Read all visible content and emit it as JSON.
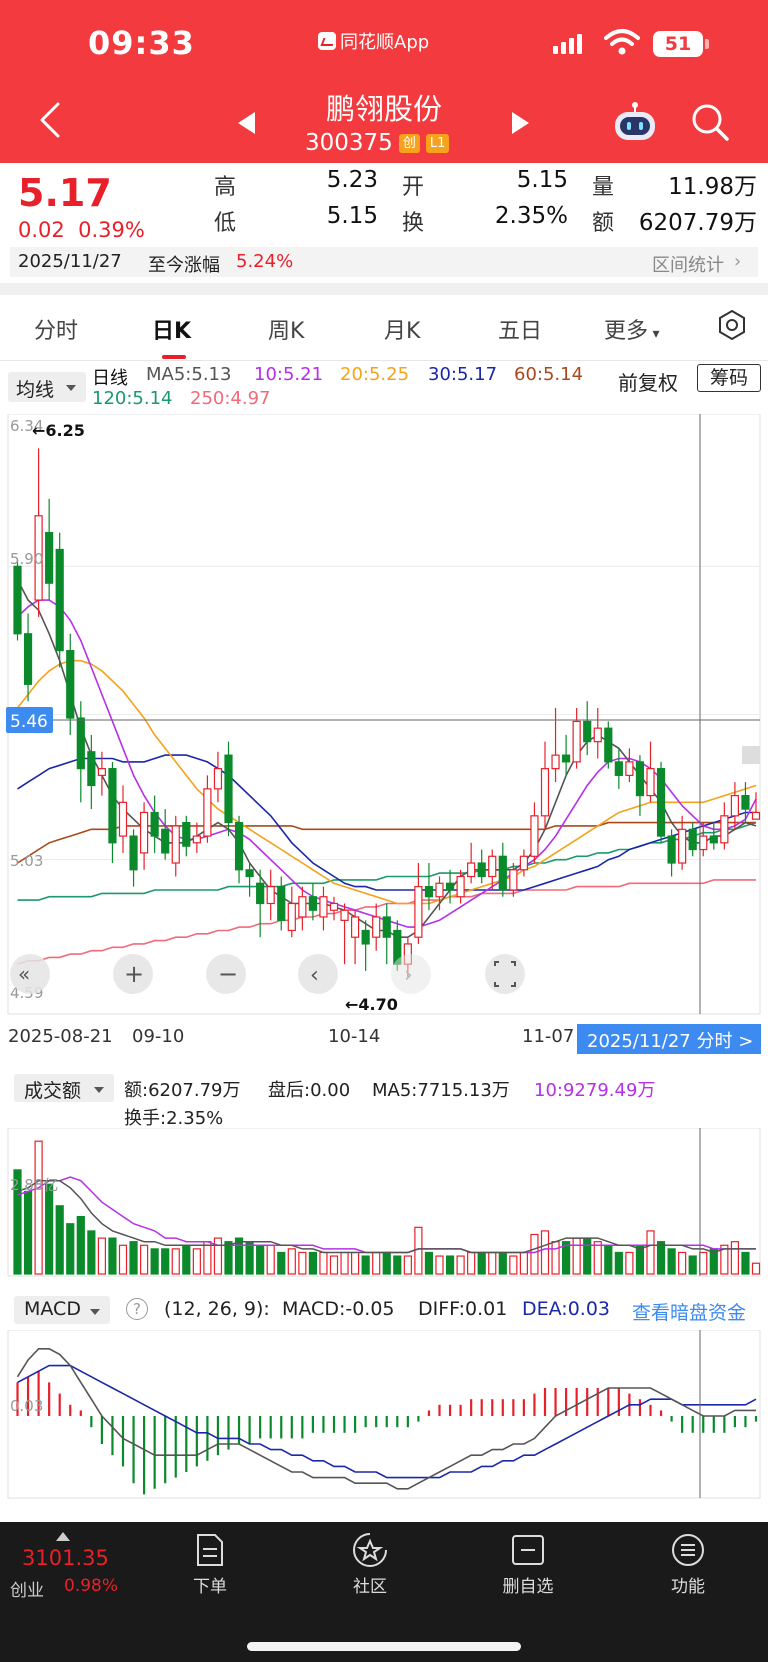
{
  "status_bar": {
    "time": "09:33",
    "app_name": "同花顺App",
    "battery": "51"
  },
  "header": {
    "stock_name": "鹏翎股份",
    "stock_code": "300375",
    "tag_board": "创",
    "tag_level": "L1"
  },
  "quote": {
    "price": "5.17",
    "change": "0.02",
    "change_pct": "0.39%",
    "high_label": "高",
    "high": "5.23",
    "low_label": "低",
    "low": "5.15",
    "open_label": "开",
    "open": "5.15",
    "turnover_label": "换",
    "turnover": "2.35%",
    "volume_label": "量",
    "volume": "11.98万",
    "amount_label": "额",
    "amount": "6207.79万",
    "date": "2025/11/27",
    "ytd_label": "至今涨幅",
    "ytd": "5.24%",
    "range_stats": "区间统计"
  },
  "tabs": [
    "分时",
    "日K",
    "周K",
    "月K",
    "五日",
    "更多"
  ],
  "active_tab": "日K",
  "ma_row": {
    "select": "均线",
    "period": "日线",
    "ma5": "MA5:5.13",
    "ma10": "10:5.21",
    "ma20": "20:5.25",
    "ma30": "30:5.17",
    "ma60": "60:5.14",
    "ma120": "120:5.14",
    "ma250": "250:4.97",
    "fuquan": "前复权",
    "chouma": "筹码"
  },
  "colors": {
    "up": "#e8202a",
    "down": "#0a8a2a",
    "ma5": "#555555",
    "ma10": "#b530e8",
    "ma20": "#f4a21c",
    "ma30": "#1a28a8",
    "ma60": "#a8491b",
    "ma120": "#1a9a6a",
    "ma250": "#f06a7a",
    "accent_blue": "#3d8bf0"
  },
  "kline": {
    "y_labels": [
      "6.34",
      "5.90",
      "5.46",
      "5.03",
      "4.59"
    ],
    "max_marker": "←6.25",
    "min_marker": "←4.70",
    "crosshair_price": "5.46",
    "dates": [
      "2025-08-21",
      "09-10",
      "10-14",
      "11-07"
    ],
    "fenshi_button": "2025/11/27 分时 >"
  },
  "chart_data": {
    "type": "candlestick",
    "ylim": [
      4.59,
      6.34
    ],
    "candles": [
      [
        5.9,
        5.7,
        5.92,
        5.68
      ],
      [
        5.7,
        5.55,
        5.76,
        5.5
      ],
      [
        5.8,
        6.05,
        6.25,
        5.75
      ],
      [
        6.0,
        5.85,
        6.1,
        5.8
      ],
      [
        5.95,
        5.65,
        6.0,
        5.6
      ],
      [
        5.65,
        5.45,
        5.7,
        5.4
      ],
      [
        5.45,
        5.3,
        5.5,
        5.2
      ],
      [
        5.35,
        5.25,
        5.4,
        5.18
      ],
      [
        5.28,
        5.3,
        5.35,
        5.22
      ],
      [
        5.3,
        5.08,
        5.32,
        5.02
      ],
      [
        5.1,
        5.2,
        5.25,
        5.05
      ],
      [
        5.1,
        5.0,
        5.12,
        4.95
      ],
      [
        5.05,
        5.17,
        5.2,
        5.0
      ],
      [
        5.17,
        5.1,
        5.22,
        5.05
      ],
      [
        5.12,
        5.05,
        5.18,
        5.03
      ],
      [
        5.02,
        5.13,
        5.16,
        4.98
      ],
      [
        5.14,
        5.07,
        5.16,
        5.04
      ],
      [
        5.08,
        5.1,
        5.14,
        5.05
      ],
      [
        5.1,
        5.24,
        5.28,
        5.08
      ],
      [
        5.24,
        5.3,
        5.35,
        5.2
      ],
      [
        5.34,
        5.14,
        5.38,
        5.1
      ],
      [
        5.14,
        5.0,
        5.16,
        4.96
      ],
      [
        5.0,
        4.98,
        5.02,
        4.92
      ],
      [
        4.96,
        4.9,
        5.0,
        4.8
      ],
      [
        4.9,
        4.95,
        5.0,
        4.85
      ],
      [
        4.95,
        4.85,
        4.98,
        4.82
      ],
      [
        4.82,
        4.9,
        4.95,
        4.8
      ],
      [
        4.86,
        4.92,
        4.95,
        4.82
      ],
      [
        4.92,
        4.88,
        4.96,
        4.85
      ],
      [
        4.86,
        4.92,
        4.95,
        4.82
      ],
      [
        4.88,
        4.9,
        4.92,
        4.85
      ],
      [
        4.85,
        4.88,
        4.9,
        4.72
      ],
      [
        4.8,
        4.86,
        4.88,
        4.72
      ],
      [
        4.82,
        4.78,
        4.85,
        4.7
      ],
      [
        4.8,
        4.86,
        4.9,
        4.76
      ],
      [
        4.86,
        4.8,
        4.9,
        4.72
      ],
      [
        4.82,
        4.72,
        4.85,
        4.7
      ],
      [
        4.72,
        4.78,
        4.8,
        4.68
      ],
      [
        4.8,
        4.95,
        5.02,
        4.78
      ],
      [
        4.95,
        4.92,
        5.02,
        4.88
      ],
      [
        4.92,
        4.96,
        4.98,
        4.88
      ],
      [
        4.96,
        4.94,
        5.0,
        4.9
      ],
      [
        4.92,
        4.98,
        5.0,
        4.9
      ],
      [
        4.98,
        5.02,
        5.08,
        4.96
      ],
      [
        5.02,
        4.98,
        5.06,
        4.96
      ],
      [
        4.98,
        5.04,
        5.06,
        4.94
      ],
      [
        5.04,
        4.94,
        5.08,
        4.92
      ],
      [
        4.94,
        5.0,
        5.02,
        4.92
      ],
      [
        5.0,
        5.04,
        5.06,
        4.98
      ],
      [
        5.04,
        5.16,
        5.2,
        5.02
      ],
      [
        5.16,
        5.3,
        5.38,
        5.12
      ],
      [
        5.3,
        5.34,
        5.48,
        5.26
      ],
      [
        5.34,
        5.32,
        5.4,
        5.28
      ],
      [
        5.32,
        5.44,
        5.48,
        5.3
      ],
      [
        5.44,
        5.38,
        5.5,
        5.34
      ],
      [
        5.38,
        5.42,
        5.48,
        5.33
      ],
      [
        5.42,
        5.32,
        5.44,
        5.3
      ],
      [
        5.32,
        5.28,
        5.36,
        5.24
      ],
      [
        5.28,
        5.32,
        5.36,
        5.26
      ],
      [
        5.32,
        5.22,
        5.34,
        5.16
      ],
      [
        5.22,
        5.3,
        5.38,
        5.2
      ],
      [
        5.3,
        5.1,
        5.32,
        5.08
      ],
      [
        5.1,
        5.02,
        5.12,
        4.98
      ],
      [
        5.02,
        5.12,
        5.16,
        5.0
      ],
      [
        5.12,
        5.06,
        5.14,
        5.04
      ],
      [
        5.06,
        5.1,
        5.14,
        5.04
      ],
      [
        5.1,
        5.08,
        5.14,
        5.06
      ],
      [
        5.08,
        5.16,
        5.2,
        5.06
      ],
      [
        5.16,
        5.22,
        5.26,
        5.12
      ],
      [
        5.22,
        5.18,
        5.26,
        5.14
      ],
      [
        5.15,
        5.17,
        5.23,
        5.15
      ]
    ],
    "ma": {
      "ma5": [
        5.86,
        5.8,
        5.77,
        5.7,
        5.62,
        5.52,
        5.42,
        5.34,
        5.28,
        5.22,
        5.18,
        5.15,
        5.12,
        5.1,
        5.08,
        5.08,
        5.08,
        5.1,
        5.12,
        5.14,
        5.12,
        5.08,
        5.02,
        4.98,
        4.94,
        4.92,
        4.9,
        4.9,
        4.9,
        4.9,
        4.89,
        4.88,
        4.86,
        4.84,
        4.82,
        4.82,
        4.8,
        4.8,
        4.82,
        4.86,
        4.9,
        4.94,
        4.98,
        5.0,
        5.0,
        5.0,
        5.0,
        5.0,
        5.02,
        5.06,
        5.12,
        5.2,
        5.28,
        5.34,
        5.38,
        5.4,
        5.38,
        5.36,
        5.32,
        5.28,
        5.24,
        5.2,
        5.14,
        5.1,
        5.08,
        5.08,
        5.1,
        5.1,
        5.12,
        5.14,
        5.13
      ],
      "ma10": [
        5.75,
        5.78,
        5.8,
        5.8,
        5.78,
        5.74,
        5.68,
        5.6,
        5.52,
        5.44,
        5.36,
        5.28,
        5.22,
        5.17,
        5.13,
        5.1,
        5.09,
        5.09,
        5.1,
        5.11,
        5.12,
        5.11,
        5.09,
        5.06,
        5.03,
        5.0,
        4.97,
        4.94,
        4.92,
        4.91,
        4.9,
        4.89,
        4.88,
        4.87,
        4.86,
        4.85,
        4.84,
        4.83,
        4.83,
        4.84,
        4.85,
        4.87,
        4.89,
        4.91,
        4.93,
        4.95,
        4.97,
        4.99,
        5.01,
        5.03,
        5.06,
        5.1,
        5.15,
        5.2,
        5.25,
        5.29,
        5.32,
        5.33,
        5.33,
        5.32,
        5.3,
        5.27,
        5.23,
        5.19,
        5.16,
        5.13,
        5.12,
        5.12,
        5.13,
        5.15,
        5.21
      ],
      "ma20": [
        5.48,
        5.52,
        5.56,
        5.59,
        5.61,
        5.62,
        5.62,
        5.61,
        5.59,
        5.56,
        5.53,
        5.49,
        5.45,
        5.4,
        5.36,
        5.32,
        5.28,
        5.24,
        5.21,
        5.18,
        5.16,
        5.14,
        5.12,
        5.1,
        5.08,
        5.06,
        5.04,
        5.02,
        5.0,
        4.98,
        4.96,
        4.95,
        4.94,
        4.93,
        4.92,
        4.91,
        4.9,
        4.9,
        4.9,
        4.9,
        4.91,
        4.92,
        4.93,
        4.94,
        4.95,
        4.96,
        4.97,
        4.98,
        5.0,
        5.01,
        5.03,
        5.05,
        5.07,
        5.09,
        5.11,
        5.13,
        5.15,
        5.17,
        5.18,
        5.19,
        5.2,
        5.2,
        5.2,
        5.2,
        5.2,
        5.2,
        5.21,
        5.22,
        5.23,
        5.24,
        5.25
      ],
      "ma30": [
        5.24,
        5.26,
        5.28,
        5.3,
        5.31,
        5.32,
        5.33,
        5.33,
        5.33,
        5.33,
        5.32,
        5.32,
        5.32,
        5.33,
        5.34,
        5.34,
        5.34,
        5.33,
        5.32,
        5.3,
        5.28,
        5.25,
        5.22,
        5.19,
        5.16,
        5.12,
        5.08,
        5.05,
        5.02,
        5.0,
        4.98,
        4.96,
        4.95,
        4.95,
        4.94,
        4.94,
        4.94,
        4.94,
        4.94,
        4.94,
        4.94,
        4.94,
        4.94,
        4.94,
        4.94,
        4.94,
        4.94,
        4.94,
        4.94,
        4.95,
        4.96,
        4.97,
        4.98,
        4.99,
        5.0,
        5.01,
        5.03,
        5.04,
        5.06,
        5.07,
        5.08,
        5.09,
        5.1,
        5.11,
        5.12,
        5.13,
        5.14,
        5.15,
        5.16,
        5.17,
        5.17
      ],
      "ma60": [
        5.02,
        5.04,
        5.06,
        5.08,
        5.09,
        5.1,
        5.11,
        5.12,
        5.12,
        5.12,
        5.13,
        5.13,
        5.13,
        5.13,
        5.13,
        5.13,
        5.13,
        5.13,
        5.13,
        5.13,
        5.13,
        5.13,
        5.13,
        5.13,
        5.13,
        5.13,
        5.13,
        5.12,
        5.12,
        5.12,
        5.12,
        5.12,
        5.12,
        5.12,
        5.12,
        5.12,
        5.12,
        5.12,
        5.12,
        5.12,
        5.12,
        5.12,
        5.12,
        5.12,
        5.12,
        5.12,
        5.12,
        5.12,
        5.12,
        5.12,
        5.12,
        5.13,
        5.13,
        5.13,
        5.13,
        5.13,
        5.14,
        5.14,
        5.14,
        5.14,
        5.14,
        5.14,
        5.14,
        5.14,
        5.14,
        5.14,
        5.14,
        5.14,
        5.14,
        5.14,
        5.14
      ],
      "ma120": [
        4.91,
        4.91,
        4.91,
        4.92,
        4.92,
        4.92,
        4.92,
        4.92,
        4.93,
        4.93,
        4.93,
        4.93,
        4.93,
        4.94,
        4.94,
        4.94,
        4.94,
        4.94,
        4.94,
        4.94,
        4.95,
        4.95,
        4.95,
        4.95,
        4.95,
        4.95,
        4.96,
        4.96,
        4.96,
        4.96,
        4.97,
        4.97,
        4.97,
        4.97,
        4.97,
        4.98,
        4.98,
        4.98,
        4.98,
        4.98,
        4.99,
        4.99,
        4.99,
        4.99,
        5.0,
        5.0,
        5.0,
        5.01,
        5.01,
        5.02,
        5.02,
        5.03,
        5.03,
        5.04,
        5.04,
        5.05,
        5.05,
        5.06,
        5.06,
        5.07,
        5.08,
        5.08,
        5.09,
        5.09,
        5.1,
        5.11,
        5.11,
        5.12,
        5.12,
        5.13,
        5.14
      ],
      "ma250": [
        4.72,
        4.73,
        4.73,
        4.74,
        4.74,
        4.75,
        4.75,
        4.76,
        4.76,
        4.77,
        4.77,
        4.78,
        4.78,
        4.79,
        4.79,
        4.8,
        4.8,
        4.81,
        4.81,
        4.82,
        4.82,
        4.83,
        4.83,
        4.84,
        4.84,
        4.85,
        4.85,
        4.86,
        4.86,
        4.87,
        4.87,
        4.88,
        4.88,
        4.89,
        4.89,
        4.9,
        4.9,
        4.9,
        4.91,
        4.91,
        4.91,
        4.92,
        4.92,
        4.92,
        4.93,
        4.93,
        4.93,
        4.93,
        4.94,
        4.94,
        4.94,
        4.94,
        4.94,
        4.95,
        4.95,
        4.95,
        4.95,
        4.95,
        4.96,
        4.96,
        4.96,
        4.96,
        4.96,
        4.96,
        4.96,
        4.96,
        4.97,
        4.97,
        4.97,
        4.97,
        4.97
      ]
    }
  },
  "volume": {
    "select": "成交额",
    "amount": "额:6207.79万",
    "after_hours": "盘后:0.00",
    "ma5": "MA5:7715.13万",
    "ma10": "10:9279.49万",
    "turnover": "换手:2.35%",
    "y_label": "2.88亿",
    "bars": [
      2.9,
      2.3,
      3.7,
      2.5,
      1.9,
      1.4,
      1.6,
      1.2,
      1.0,
      1.0,
      0.8,
      0.9,
      0.8,
      0.7,
      0.7,
      0.7,
      0.8,
      0.7,
      0.9,
      1.0,
      0.9,
      1.0,
      0.9,
      0.8,
      0.8,
      0.6,
      0.7,
      0.6,
      0.6,
      0.6,
      0.5,
      0.6,
      0.6,
      0.5,
      0.6,
      0.6,
      0.5,
      0.5,
      1.3,
      0.6,
      0.5,
      0.5,
      0.5,
      0.6,
      0.6,
      0.6,
      0.6,
      0.5,
      0.6,
      1.1,
      1.2,
      0.9,
      0.9,
      1.0,
      1.0,
      0.9,
      0.8,
      0.6,
      0.6,
      0.8,
      1.2,
      0.9,
      0.7,
      0.6,
      0.5,
      0.6,
      0.7,
      0.8,
      0.9,
      0.6,
      0.3
    ],
    "ma5_line": [
      2.3,
      2.4,
      2.6,
      2.6,
      2.6,
      2.4,
      2.1,
      1.7,
      1.4,
      1.2,
      1.1,
      1.0,
      0.9,
      0.9,
      0.8,
      0.8,
      0.8,
      0.8,
      0.8,
      0.8,
      0.8,
      0.9,
      0.9,
      0.9,
      0.9,
      0.8,
      0.8,
      0.7,
      0.7,
      0.6,
      0.6,
      0.6,
      0.6,
      0.6,
      0.6,
      0.6,
      0.6,
      0.6,
      0.7,
      0.7,
      0.7,
      0.7,
      0.7,
      0.6,
      0.6,
      0.6,
      0.6,
      0.6,
      0.6,
      0.7,
      0.8,
      0.9,
      1.0,
      1.0,
      1.0,
      1.0,
      0.9,
      0.8,
      0.8,
      0.7,
      0.8,
      0.8,
      0.8,
      0.8,
      0.7,
      0.7,
      0.6,
      0.7,
      0.7,
      0.7,
      0.7
    ],
    "ma10_line": [
      2.2,
      2.3,
      2.4,
      2.6,
      2.6,
      2.7,
      2.6,
      2.3,
      2.0,
      1.8,
      1.6,
      1.4,
      1.3,
      1.2,
      1.0,
      1.0,
      0.9,
      0.9,
      0.9,
      0.8,
      0.8,
      0.8,
      0.8,
      0.8,
      0.8,
      0.8,
      0.8,
      0.8,
      0.8,
      0.7,
      0.7,
      0.7,
      0.7,
      0.6,
      0.6,
      0.6,
      0.6,
      0.6,
      0.7,
      0.7,
      0.7,
      0.7,
      0.7,
      0.6,
      0.6,
      0.6,
      0.6,
      0.6,
      0.6,
      0.6,
      0.7,
      0.7,
      0.8,
      0.8,
      0.8,
      0.8,
      0.8,
      0.8,
      0.8,
      0.8,
      0.8,
      0.8,
      0.8,
      0.8,
      0.8,
      0.8,
      0.7,
      0.7,
      0.7,
      0.7,
      0.7
    ]
  },
  "macd": {
    "select": "MACD",
    "params": "(12, 26, 9):",
    "macd": "MACD:-0.05",
    "diff": "DIFF:0.01",
    "dea": "DEA:0.03",
    "link": "查看暗盘资金",
    "y_label": "0.03",
    "hist": [
      0.06,
      0.07,
      0.08,
      0.06,
      0.04,
      0.02,
      0.01,
      -0.02,
      -0.05,
      -0.07,
      -0.09,
      -0.12,
      -0.14,
      -0.13,
      -0.12,
      -0.11,
      -0.1,
      -0.09,
      -0.08,
      -0.07,
      -0.06,
      -0.05,
      -0.05,
      -0.04,
      -0.04,
      -0.04,
      -0.04,
      -0.04,
      -0.03,
      -0.03,
      -0.03,
      -0.03,
      -0.03,
      -0.02,
      -0.02,
      -0.02,
      -0.02,
      -0.02,
      -0.01,
      0.01,
      0.02,
      0.02,
      0.02,
      0.03,
      0.03,
      0.03,
      0.03,
      0.03,
      0.03,
      0.04,
      0.05,
      0.05,
      0.05,
      0.05,
      0.05,
      0.05,
      0.05,
      0.05,
      0.04,
      0.03,
      0.02,
      0.01,
      -0.01,
      -0.03,
      -0.03,
      -0.03,
      -0.03,
      -0.03,
      -0.02,
      -0.02,
      -0.01
    ],
    "diff_line": [
      0.07,
      0.1,
      0.12,
      0.12,
      0.11,
      0.09,
      0.06,
      0.03,
      0.0,
      -0.02,
      -0.04,
      -0.05,
      -0.06,
      -0.07,
      -0.07,
      -0.07,
      -0.07,
      -0.07,
      -0.06,
      -0.05,
      -0.05,
      -0.05,
      -0.06,
      -0.07,
      -0.08,
      -0.09,
      -0.1,
      -0.1,
      -0.11,
      -0.11,
      -0.11,
      -0.11,
      -0.12,
      -0.12,
      -0.12,
      -0.12,
      -0.13,
      -0.13,
      -0.12,
      -0.11,
      -0.1,
      -0.09,
      -0.08,
      -0.07,
      -0.07,
      -0.06,
      -0.06,
      -0.05,
      -0.05,
      -0.04,
      -0.02,
      0.0,
      0.01,
      0.02,
      0.03,
      0.04,
      0.05,
      0.05,
      0.05,
      0.05,
      0.05,
      0.04,
      0.03,
      0.02,
      0.01,
      0.0,
      0.0,
      0.0,
      0.01,
      0.01,
      0.01
    ],
    "dea_line": [
      0.06,
      0.07,
      0.08,
      0.09,
      0.09,
      0.09,
      0.08,
      0.07,
      0.06,
      0.05,
      0.04,
      0.03,
      0.02,
      0.01,
      0.0,
      -0.01,
      -0.02,
      -0.03,
      -0.03,
      -0.04,
      -0.04,
      -0.04,
      -0.05,
      -0.05,
      -0.06,
      -0.06,
      -0.07,
      -0.07,
      -0.08,
      -0.08,
      -0.09,
      -0.09,
      -0.1,
      -0.1,
      -0.1,
      -0.11,
      -0.11,
      -0.11,
      -0.11,
      -0.11,
      -0.11,
      -0.1,
      -0.1,
      -0.1,
      -0.09,
      -0.09,
      -0.08,
      -0.08,
      -0.07,
      -0.07,
      -0.06,
      -0.05,
      -0.04,
      -0.03,
      -0.02,
      -0.01,
      0.0,
      0.01,
      0.02,
      0.02,
      0.03,
      0.03,
      0.03,
      0.02,
      0.02,
      0.02,
      0.02,
      0.02,
      0.02,
      0.02,
      0.03
    ]
  },
  "bottom_nav": {
    "index_value": "3101.35",
    "index_name": "创业",
    "index_change": "0.98%",
    "items": [
      "下单",
      "社区",
      "删自选",
      "功能"
    ]
  }
}
